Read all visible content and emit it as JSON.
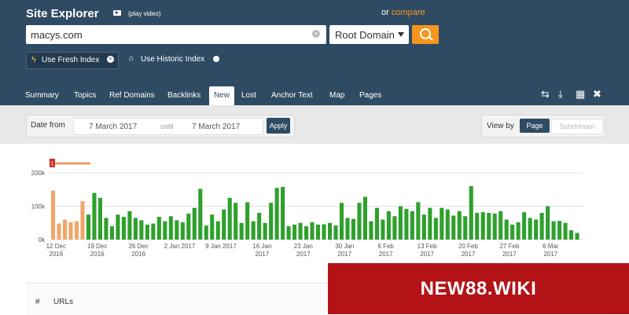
{
  "header": {
    "title": "Site Explorer",
    "play_video": "(play video)",
    "or_text": "or",
    "compare_link": "compare"
  },
  "search": {
    "value": "macys.com",
    "mode": "Root Domain"
  },
  "index_options": {
    "fresh": "Use Fresh Index",
    "historic": "Use Historic Index"
  },
  "tabs": [
    "Summary",
    "Topics",
    "Ref Domains",
    "Backlinks",
    "New",
    "Lost",
    "Anchor Text",
    "Map",
    "Pages"
  ],
  "active_tab": "New",
  "date_filter": {
    "label": "Date from",
    "from": "7 March 2017",
    "until": "until",
    "to": "7 March 2017",
    "apply": "Apply"
  },
  "view_by": {
    "label": "View by",
    "page": "Page",
    "subdomain": "Subdomain"
  },
  "colors": {
    "header_bg": "#2f4b64",
    "accent_orange": "#f7941d",
    "bar_green": "#2ea02c",
    "bar_orange": "#f0a66a",
    "watermark_red": "#b31217"
  },
  "chart_data": {
    "type": "bar",
    "y_ticks": [
      "0k",
      "100k",
      "200k"
    ],
    "ylim": [
      0,
      200000
    ],
    "range_marker": "1",
    "x_tick_labels": [
      [
        "12 Dec",
        "2016"
      ],
      [
        "19 Dec",
        "2016"
      ],
      [
        "26 Dec",
        "2016"
      ],
      [
        "2 Jan 2017"
      ],
      [
        "9 Jan 2017"
      ],
      [
        "16 Jan",
        "2017"
      ],
      [
        "23 Jan",
        "2017"
      ],
      [
        "30 Jan",
        "2017"
      ],
      [
        "6 Feb",
        "2017"
      ],
      [
        "13 Feb",
        "2017"
      ],
      [
        "20 Feb",
        "2017"
      ],
      [
        "27 Feb",
        "2017"
      ],
      [
        "6 Mar",
        "2017"
      ]
    ],
    "values": [
      147000,
      48000,
      60000,
      52000,
      55000,
      115000,
      75000,
      140000,
      125000,
      65000,
      40000,
      75000,
      68000,
      85000,
      65000,
      58000,
      45000,
      48000,
      68000,
      55000,
      70000,
      58000,
      52000,
      78000,
      95000,
      152000,
      42000,
      75000,
      55000,
      90000,
      125000,
      110000,
      50000,
      112000,
      55000,
      80000,
      50000,
      110000,
      155000,
      158000,
      40000,
      45000,
      50000,
      40000,
      52000,
      45000,
      46000,
      50000,
      42000,
      110000,
      65000,
      62000,
      110000,
      128000,
      55000,
      95000,
      60000,
      85000,
      70000,
      100000,
      92000,
      85000,
      112000,
      75000,
      95000,
      65000,
      95000,
      90000,
      72000,
      85000,
      70000,
      160000,
      80000,
      82000,
      80000,
      78000,
      85000,
      60000,
      45000,
      52000,
      82000,
      65000,
      60000,
      80000,
      100000,
      55000,
      56000,
      50000,
      28000,
      20000
    ],
    "orange_count": 6
  },
  "table": {
    "hash": "#",
    "urls": "URLs"
  },
  "watermark": "NEW88.WIKI"
}
